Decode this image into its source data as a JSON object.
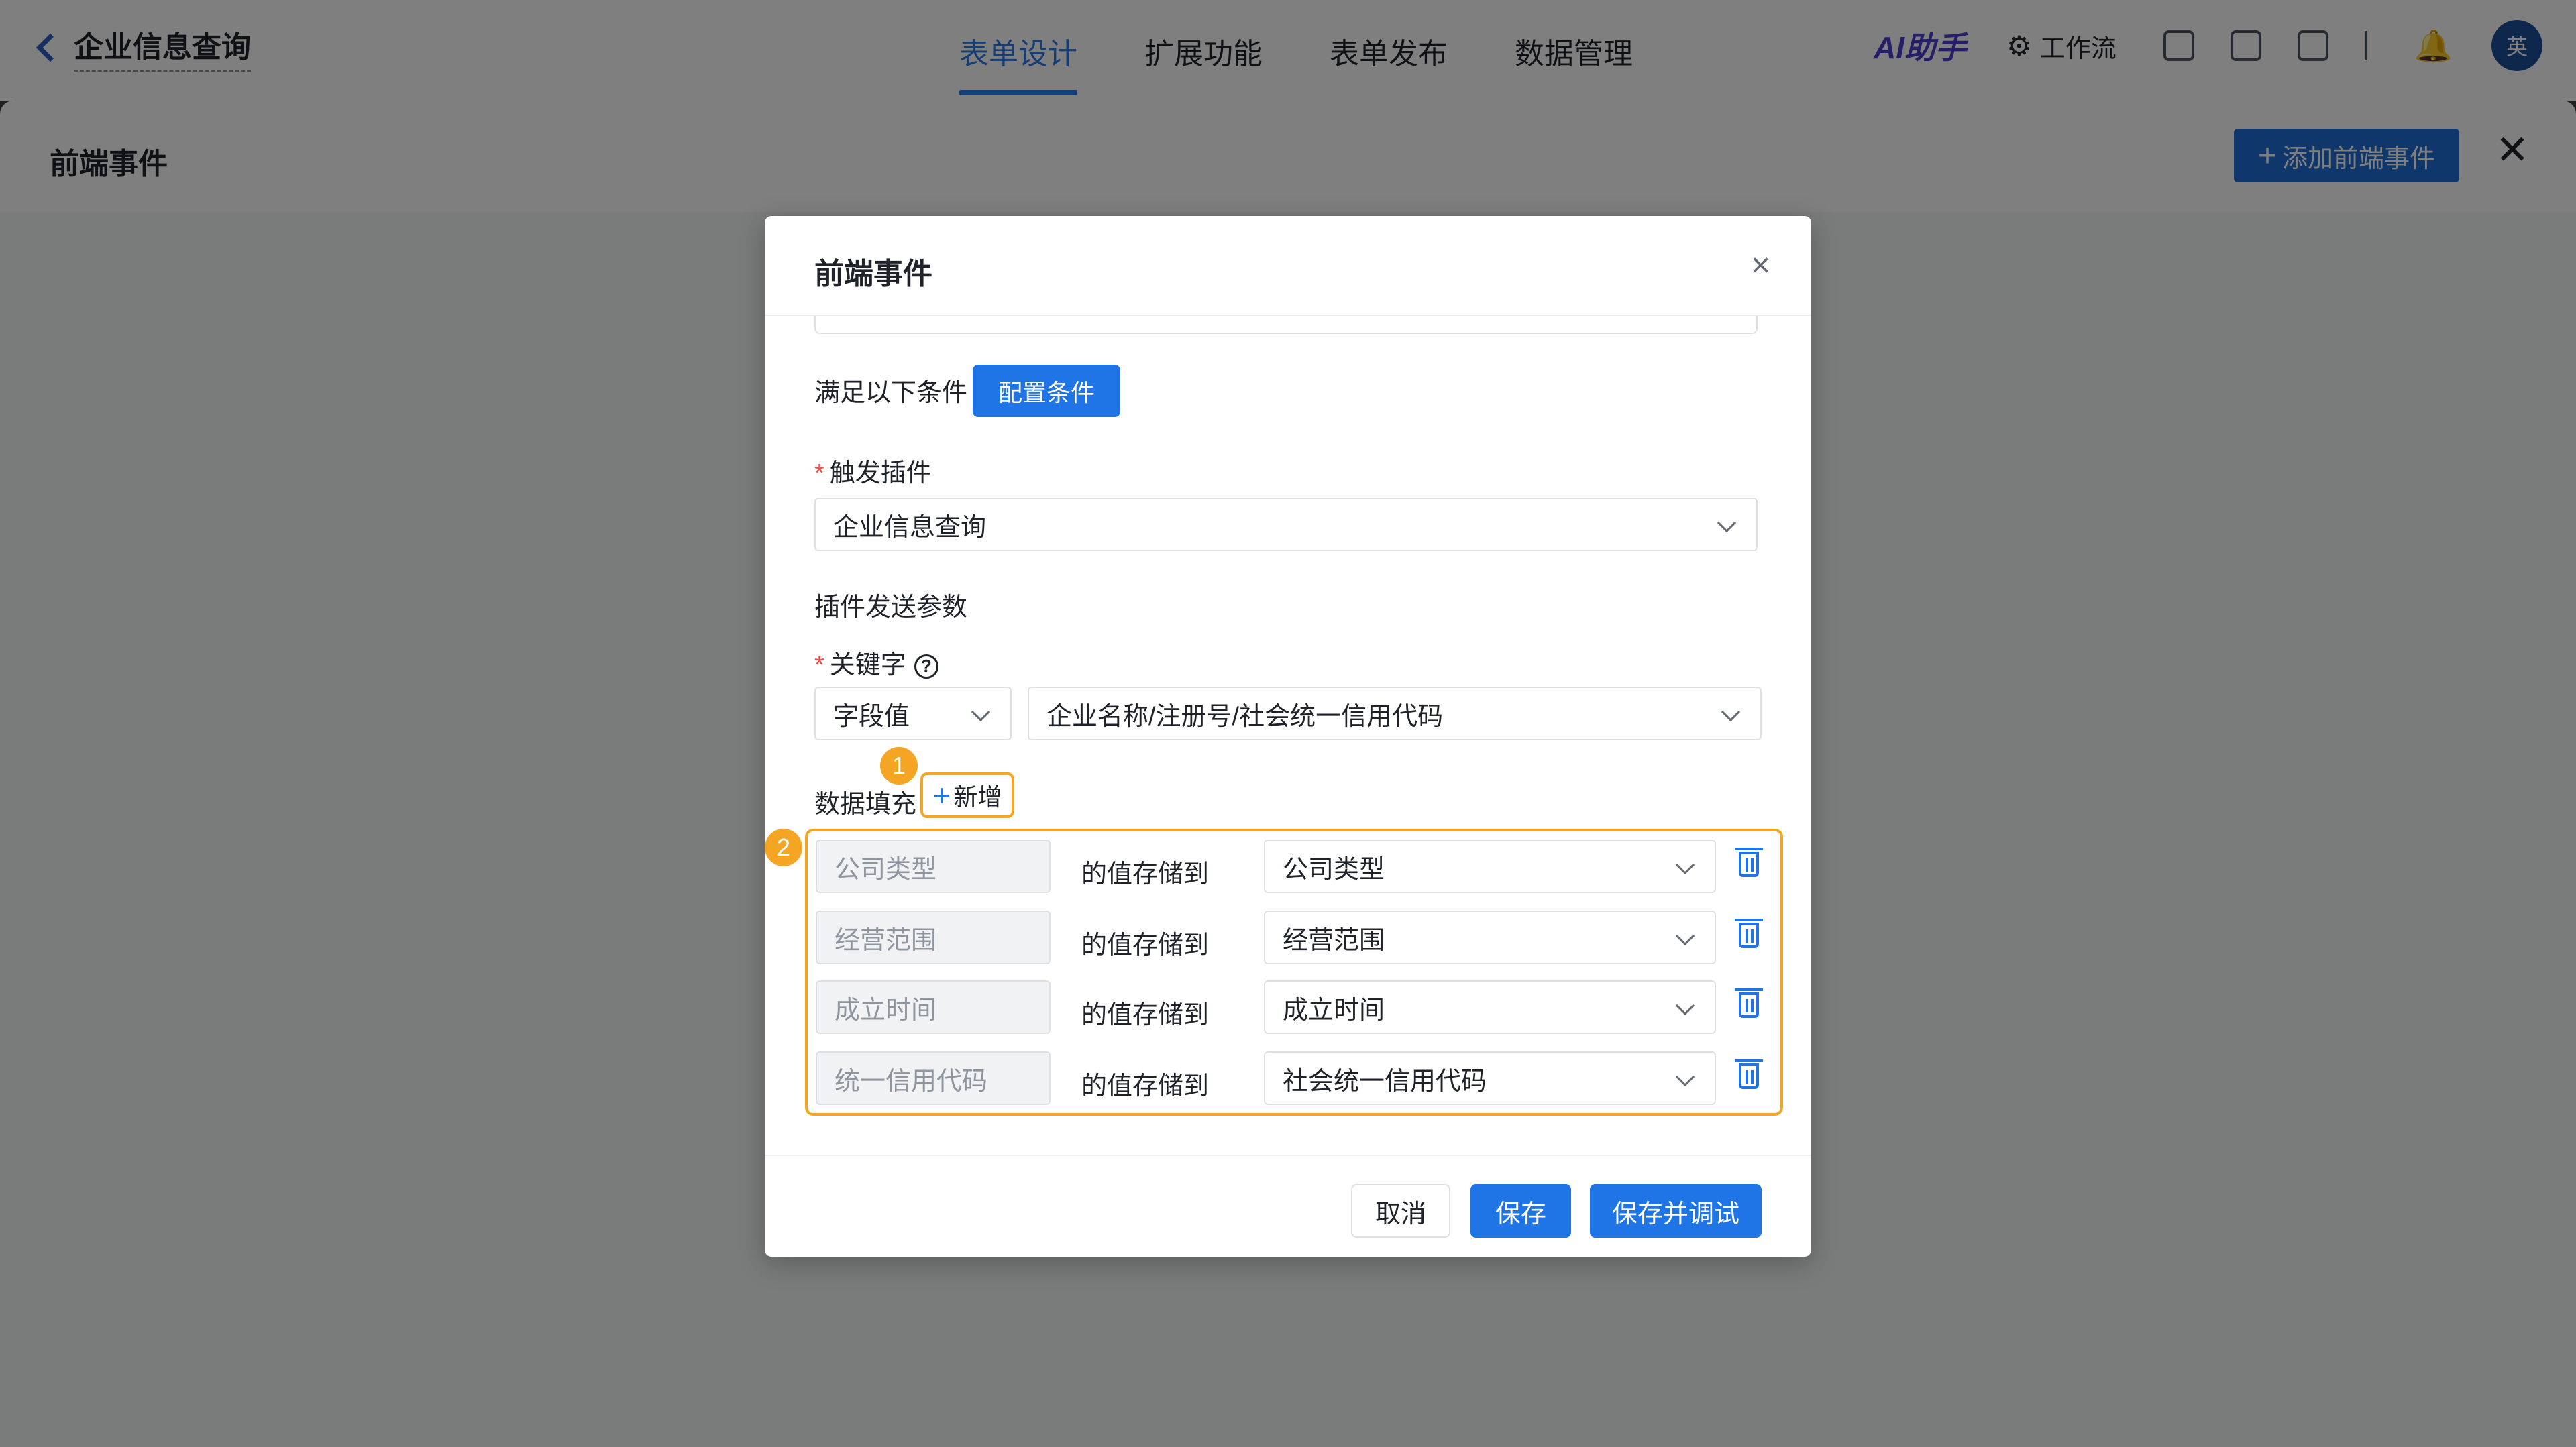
{
  "app": {
    "title": "企业信息查询"
  },
  "nav": {
    "tabs": [
      "表单设计",
      "扩展功能",
      "表单发布",
      "数据管理"
    ],
    "active_index": 0
  },
  "tools": {
    "ai_label": "AI助手",
    "workflow_label": "工作流",
    "avatar_text": "英"
  },
  "drawer": {
    "title": "前端事件",
    "add_button": "添加前端事件"
  },
  "modal": {
    "title": "前端事件",
    "condition_label": "满足以下条件",
    "condition_button": "配置条件",
    "trigger_plugin_label": "触发插件",
    "trigger_plugin_value": "企业信息查询",
    "plugin_params_label": "插件发送参数",
    "keyword_label": "关键字",
    "keyword_help": "?",
    "keyword_type_value": "字段值",
    "keyword_field_value": "企业名称/注册号/社会统一信用代码",
    "data_fill_label": "数据填充",
    "new_button": "新增",
    "badge_1": "1",
    "badge_2": "2",
    "mapping_connector": "的值存储到",
    "mappings": [
      {
        "source": "公司类型",
        "target": "公司类型"
      },
      {
        "source": "经营范围",
        "target": "经营范围"
      },
      {
        "source": "成立时间",
        "target": "成立时间"
      },
      {
        "source": "统一信用代码",
        "target": "社会统一信用代码"
      }
    ],
    "cancel_button": "取消",
    "save_button": "保存",
    "save_debug_button": "保存并调试"
  },
  "colors": {
    "primary": "#1f75e6",
    "highlight": "#f5a524",
    "ai": "#4a3fd1"
  }
}
